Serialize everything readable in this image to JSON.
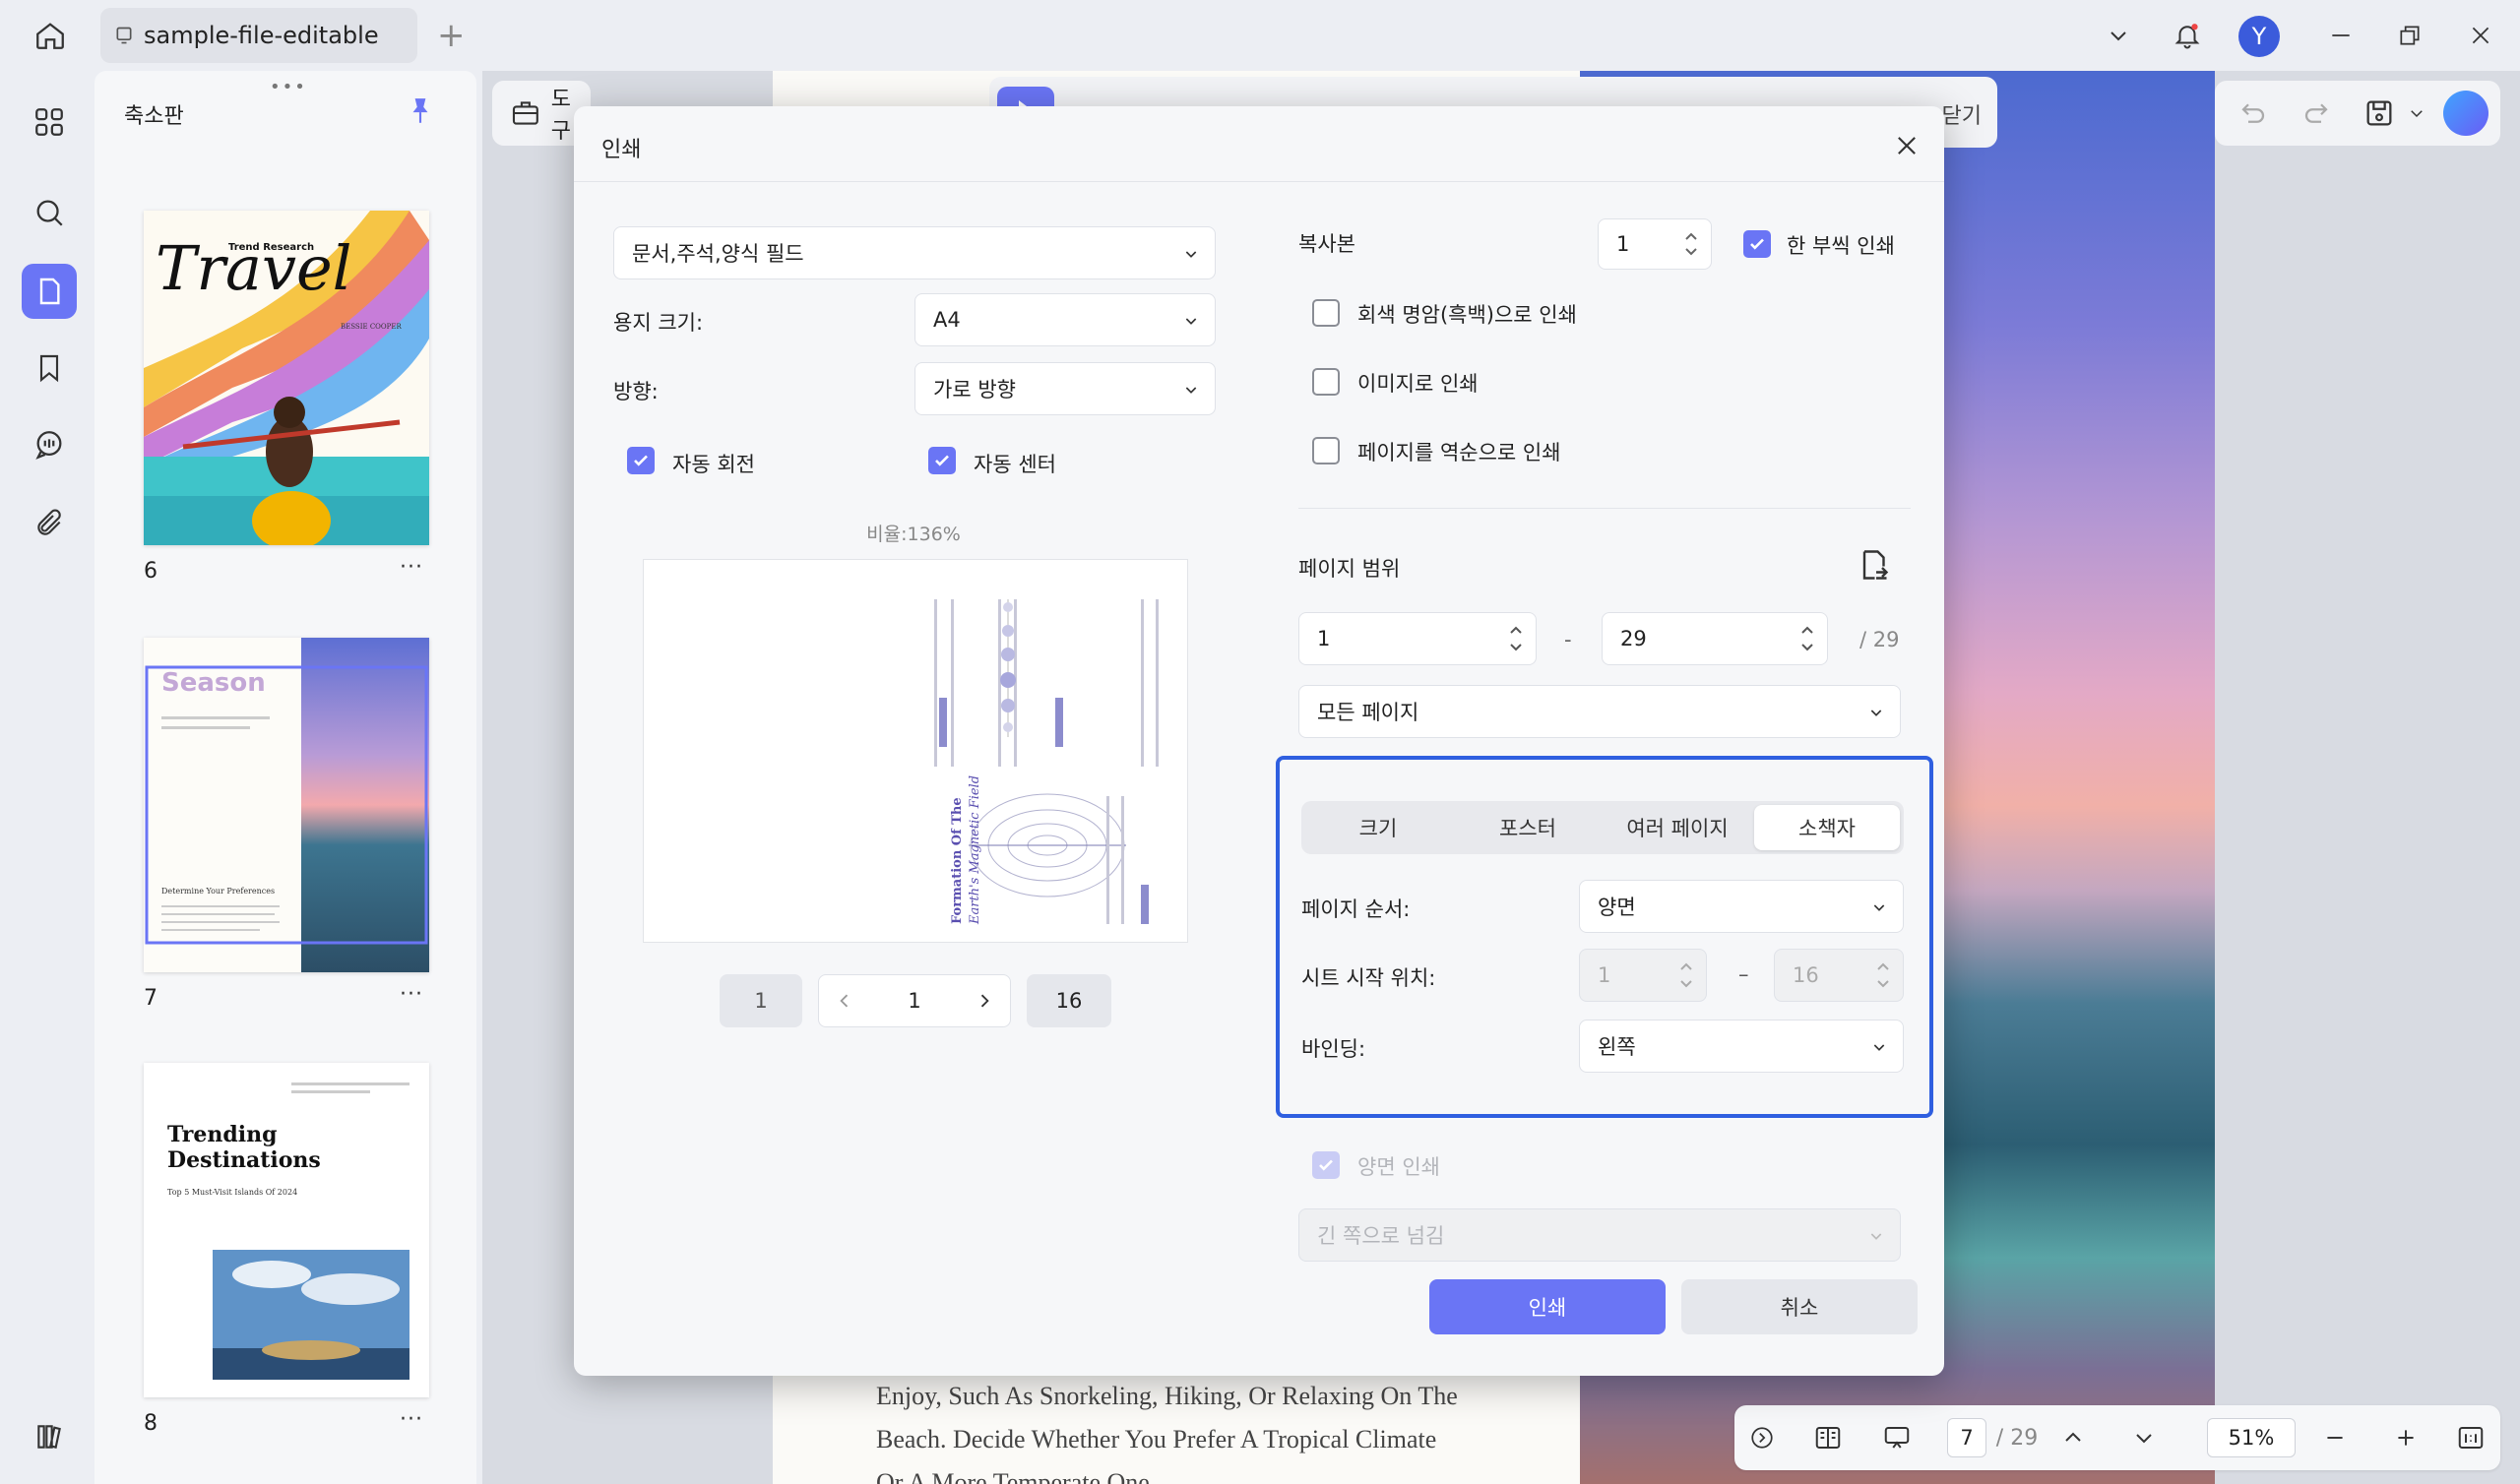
{
  "titlebar": {
    "tab_title": "sample-file-editable",
    "new_tab": "+",
    "avatar_letter": "Y"
  },
  "thumbnails": {
    "title": "축소판",
    "pages": [
      {
        "number": "6",
        "more": "···",
        "heading": "Travel",
        "sub": "Trend Research",
        "author": "BESSIE COOPER"
      },
      {
        "number": "7",
        "more": "···",
        "heading": "Season",
        "sub": "Determine Your Preferences"
      },
      {
        "number": "8",
        "more": "···",
        "heading": "Trending Destinations",
        "sub": "Top 5 Must-Visit Islands Of 2024"
      }
    ]
  },
  "toolbar": {
    "tools_label": "도구",
    "close_label": "닫기"
  },
  "document": {
    "text_lines": [
      "Enjoy, Such As Snorkeling, Hiking, Or Relaxing On The",
      "Beach. Decide Whether You Prefer A Tropical Climate",
      "Or A More Temperate One."
    ]
  },
  "bottombar": {
    "current_page": "7",
    "total_pages": "/ 29",
    "zoom": "51%"
  },
  "dialog": {
    "title": "인쇄",
    "content_select": "문서,주석,양식 필드",
    "paper_size_label": "용지 크기:",
    "paper_size_value": "A4",
    "orientation_label": "방향:",
    "orientation_value": "가로 방향",
    "auto_rotate_label": "자동 회전",
    "auto_center_label": "자동 센터",
    "ratio_label": "비율:136%",
    "preview": {
      "title_line1": "Formation Of The",
      "title_line2": "Earth's Magnetic Field",
      "first_page": "1",
      "current_page": "1",
      "last_page": "16"
    },
    "copies_label": "복사본",
    "copies_value": "1",
    "collate_label": "한 부씩 인쇄",
    "grayscale_label": "회색 명암(흑백)으로 인쇄",
    "as_image_label": "이미지로 인쇄",
    "reverse_label": "페이지를 역순으로 인쇄",
    "page_range_label": "페이지 범위",
    "range_from": "1",
    "range_dash": "-",
    "range_to": "29",
    "range_total": "/ 29",
    "pages_select": "모든 페이지",
    "tabs": [
      "크기",
      "포스터",
      "여러 페이지",
      "소책자"
    ],
    "page_order_label": "페이지 순서:",
    "page_order_value": "양면",
    "sheet_start_label": "시트 시작 위치:",
    "sheet_start_from": "1",
    "sheet_dash": "–",
    "sheet_start_to": "16",
    "binding_label": "바인딩:",
    "binding_value": "왼쪽",
    "duplex_label": "양면 인쇄",
    "flip_select": "긴 쪽으로 넘김",
    "print_button": "인쇄",
    "cancel_button": "취소"
  },
  "colors": {
    "accent": "#6a75f5",
    "highlight_border": "#2f5fe0",
    "avatar": "#3b5bdb"
  }
}
